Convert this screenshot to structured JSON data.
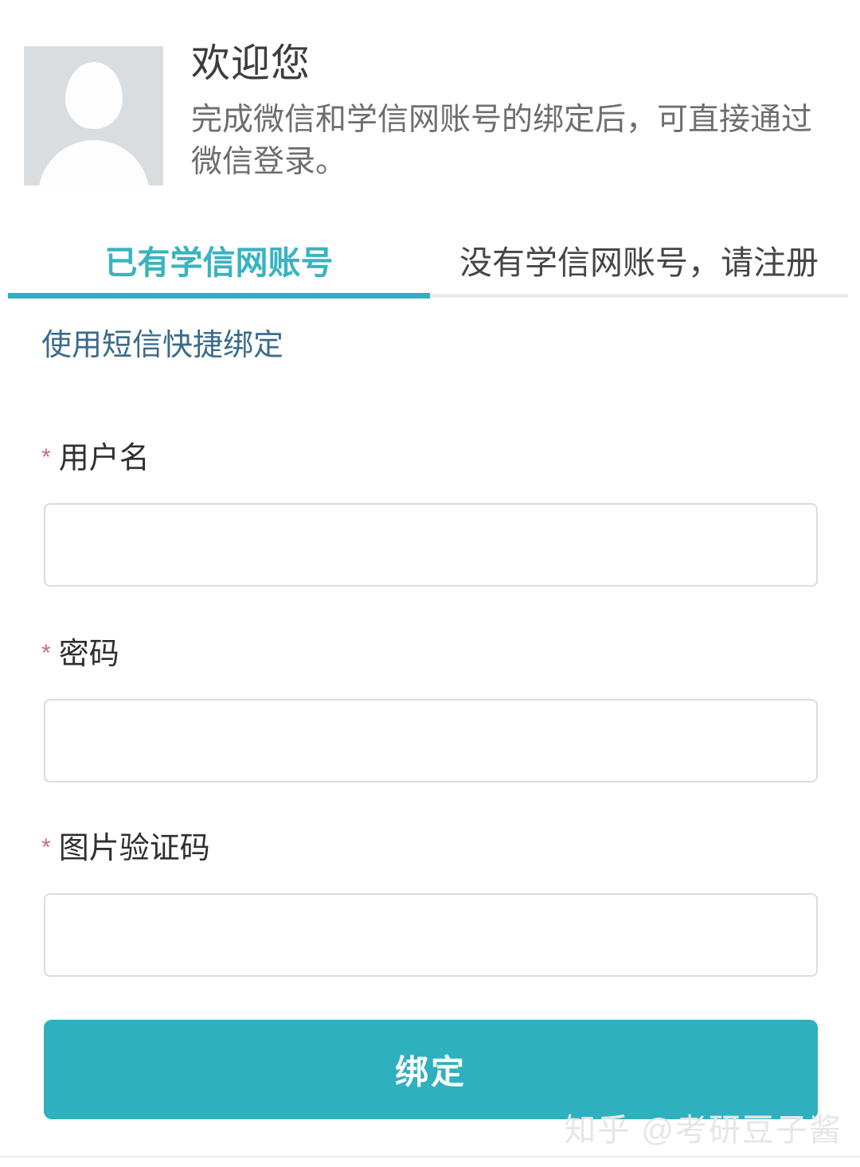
{
  "header": {
    "avatar_icon": "default-user-avatar-icon",
    "title": "欢迎您",
    "subtitle": "完成微信和学信网账号的绑定后，可直接通过微信登录。"
  },
  "tabs": [
    {
      "label": "已有学信网账号",
      "active": true
    },
    {
      "label": "没有学信网账号，请注册",
      "active": false
    }
  ],
  "links": {
    "sms_quick_bind": "使用短信快捷绑定"
  },
  "form": {
    "required_marker": "*",
    "fields": [
      {
        "label": "用户名",
        "value": "",
        "placeholder": "",
        "type": "text"
      },
      {
        "label": "密码",
        "value": "",
        "placeholder": "",
        "type": "password"
      },
      {
        "label": "图片验证码",
        "value": "",
        "placeholder": "",
        "type": "text"
      }
    ],
    "submit_label": "绑定"
  },
  "watermark": "知乎 @考研豆子酱",
  "colors": {
    "accent_teal": "#2fb0be",
    "tab_active_text": "#39b3c0",
    "tab_inactive_text": "#464646",
    "link_blue": "#3a6b8c",
    "required_star": "#c86a7a",
    "avatar_bg": "#d9dde0",
    "input_border": "#dcdcdc",
    "watermark_gray": "#e6e6e6"
  }
}
